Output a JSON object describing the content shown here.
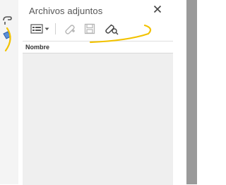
{
  "panel": {
    "title": "Archivos adjuntos",
    "close_glyph": "✕"
  },
  "toolbar": {
    "items": [
      {
        "name": "view-options",
        "icon": "list-view-icon",
        "has_dropdown": true
      },
      {
        "name": "attach-file",
        "icon": "paperclip-add-icon",
        "disabled": true
      },
      {
        "name": "save-attachment",
        "icon": "save-icon",
        "disabled": true
      },
      {
        "name": "search-attachment",
        "icon": "paperclip-search-icon",
        "disabled": false
      }
    ]
  },
  "table": {
    "columns": [
      "Nombre"
    ],
    "rows": []
  },
  "colors": {
    "panel_background": "#ffffff",
    "list_background": "#efefef",
    "right_bar": "#9a9a9a",
    "annotation": "#f2c200",
    "icon_active": "#444444",
    "icon_disabled": "#b5b5b5"
  }
}
